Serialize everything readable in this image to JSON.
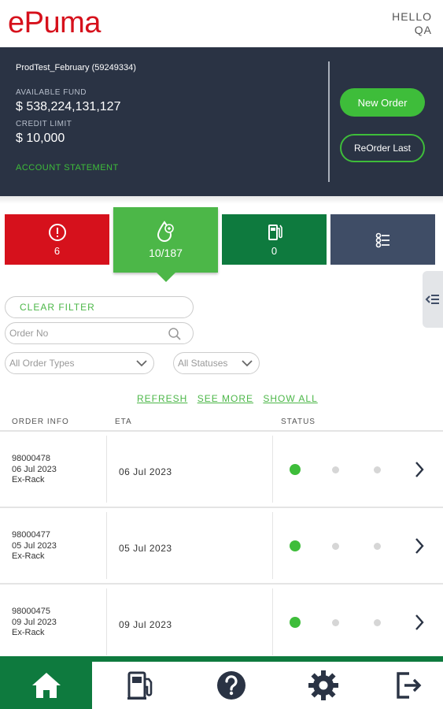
{
  "header": {
    "logo": "ePuma",
    "greeting_line1": "HELLO",
    "greeting_line2": "QA"
  },
  "account": {
    "name": "ProdTest_February (59249334)",
    "available_fund_label": "AVAILABLE FUND",
    "available_fund": "$ 538,224,131,127",
    "credit_limit_label": "CREDIT LIMIT",
    "credit_limit": "$ 10,000",
    "statement_link": "ACCOUNT STATEMENT",
    "new_order_label": "New Order",
    "reorder_label": "ReOrder Last"
  },
  "tiles": [
    {
      "icon": "alert-icon",
      "count": "6",
      "color": "#d6111c"
    },
    {
      "icon": "fuel-drop-icon",
      "count": "10/187",
      "color": "#4cb748"
    },
    {
      "icon": "fuel-pump-icon",
      "count": "0",
      "color": "#0e7a3e"
    },
    {
      "icon": "list-filter-icon",
      "count": "",
      "color": "#3f4d66"
    }
  ],
  "filters": {
    "clear_filter": "CLEAR FILTER",
    "order_no_placeholder": "Order No",
    "order_types": "All Order Types",
    "statuses": "All Statuses"
  },
  "links": {
    "refresh": "REFRESH",
    "see_more": "SEE MORE",
    "show_all": "SHOW ALL"
  },
  "table": {
    "headers": {
      "order_info": "ORDER INFO",
      "eta": "ETA",
      "status": "STATUS"
    },
    "rows": [
      {
        "order_no": "98000478",
        "order_date": "06 Jul 2023",
        "type": "Ex-Rack",
        "eta": "06 Jul 2023",
        "status_step": 1
      },
      {
        "order_no": "98000477",
        "order_date": "05 Jul 2023",
        "type": "Ex-Rack",
        "eta": "05 Jul 2023",
        "status_step": 1
      },
      {
        "order_no": "98000475",
        "order_date": "09 Jul 2023",
        "type": "Ex-Rack",
        "eta": "09 Jul 2023",
        "status_step": 1
      }
    ]
  },
  "bottom_nav": [
    {
      "icon": "home-icon",
      "active": true
    },
    {
      "icon": "fuel-station-icon",
      "active": false
    },
    {
      "icon": "help-icon",
      "active": false
    },
    {
      "icon": "settings-gear-icon",
      "active": false
    },
    {
      "icon": "logout-icon",
      "active": false
    }
  ],
  "colors": {
    "brand_red": "#d6111c",
    "brand_green": "#4cb748",
    "dark_green": "#0e7a3e",
    "panel_navy": "#2a3344"
  }
}
